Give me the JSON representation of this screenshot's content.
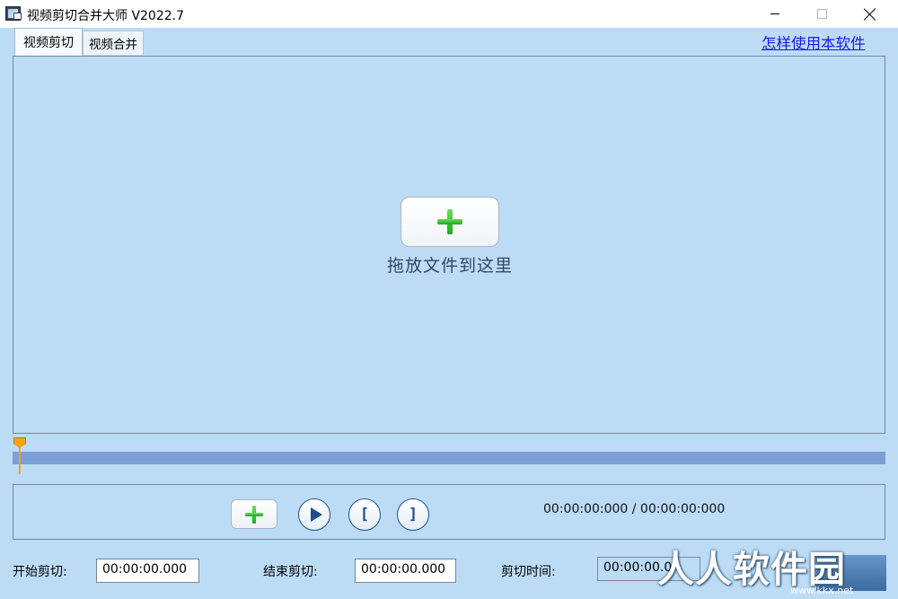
{
  "window": {
    "title": "视频剪切合并大师 V2022.7"
  },
  "tabs": [
    {
      "label": "视频剪切",
      "active": true
    },
    {
      "label": "视频合并",
      "active": false
    }
  ],
  "help_link": "怎样使用本软件",
  "drop_zone": {
    "text": "拖放文件到这里"
  },
  "controls": {
    "mark_in_glyph": "[",
    "mark_out_glyph": "]",
    "time_display": "00:00:00:000 / 00:00:00:000"
  },
  "fields": {
    "start_label": "开始剪切:",
    "start_value": "00:00:00.000",
    "end_label": "结束剪切:",
    "end_value": "00:00:00.000",
    "duration_label": "剪切时间:",
    "duration_value": "00:00:00.0"
  },
  "watermark": {
    "text": "人人软件园",
    "sub": "www.kkx.net"
  },
  "colors": {
    "background": "#bcdcf6",
    "track": "#7b9fd4",
    "playhead": "#f3a11b",
    "accent": "#1f4f8a",
    "link": "#1a1ae8",
    "plus_green": "#2fbf2a"
  }
}
